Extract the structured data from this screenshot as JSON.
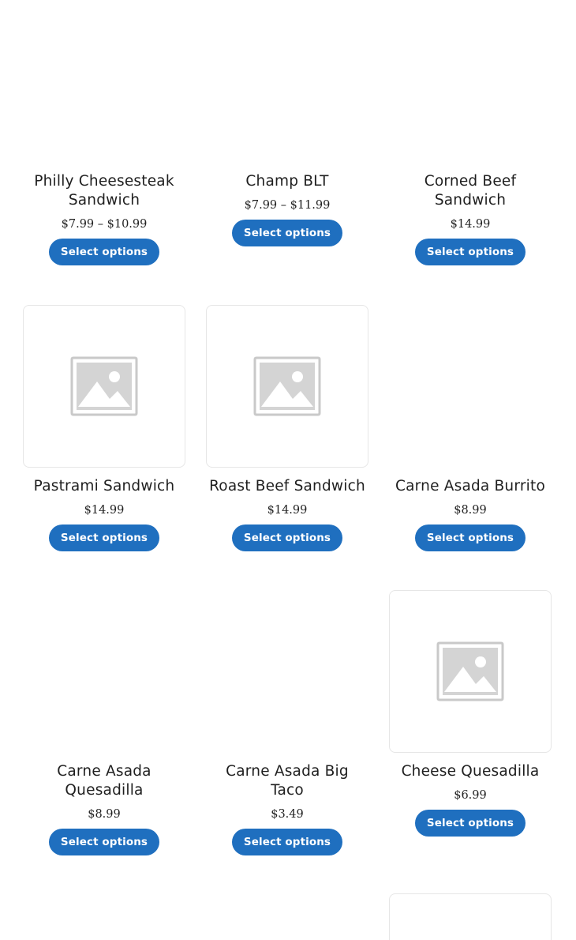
{
  "products": [
    {
      "name": "Philly Cheesesteak Sandwich",
      "price": "$7.99 – $10.99",
      "button": "Select options",
      "has_image_placeholder": false
    },
    {
      "name": "Champ BLT",
      "price": "$7.99 – $11.99",
      "button": "Select options",
      "has_image_placeholder": false
    },
    {
      "name": "Corned Beef Sandwich",
      "price": "$14.99",
      "button": "Select options",
      "has_image_placeholder": false
    },
    {
      "name": "Pastrami Sandwich",
      "price": "$14.99",
      "button": "Select options",
      "has_image_placeholder": true
    },
    {
      "name": "Roast Beef Sandwich",
      "price": "$14.99",
      "button": "Select options",
      "has_image_placeholder": true
    },
    {
      "name": "Carne Asada Burrito",
      "price": "$8.99",
      "button": "Select options",
      "has_image_placeholder": false
    },
    {
      "name": "Carne Asada Quesadilla",
      "price": "$8.99",
      "button": "Select options",
      "has_image_placeholder": false
    },
    {
      "name": "Carne Asada Big Taco",
      "price": "$3.49",
      "button": "Select options",
      "has_image_placeholder": false
    },
    {
      "name": "Cheese Quesadilla",
      "price": "$6.99",
      "button": "Select options",
      "has_image_placeholder": true
    },
    {
      "has_image_placeholder": true
    }
  ],
  "colors": {
    "button_bg": "#1f6fbf",
    "button_text": "#ffffff",
    "placeholder_icon": "#c8c8c8",
    "thumb_border": "#e6e6e6"
  },
  "icons": {
    "placeholder": "image-placeholder-icon"
  }
}
